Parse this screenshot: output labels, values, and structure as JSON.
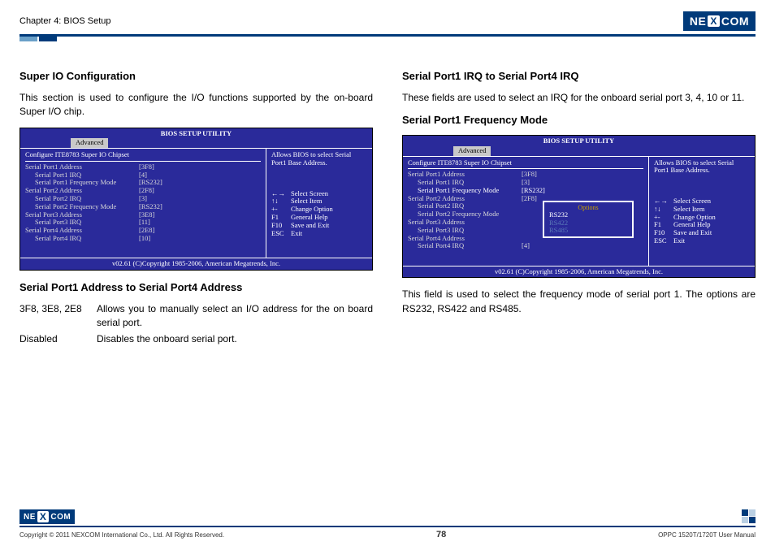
{
  "header": {
    "chapter": "Chapter 4: BIOS Setup",
    "brand_pre": "NE",
    "brand_x": "X",
    "brand_post": "COM"
  },
  "left": {
    "h1": "Super IO Configuration",
    "p1": "This section is used to configure the I/O functions supported by the on-board Super I/O chip.",
    "h2": "Serial Port1 Address to Serial Port4 Address",
    "defs": [
      {
        "k": "3F8, 3E8, 2E8",
        "v": "Allows you to manually select an I/O address for the on board serial port."
      },
      {
        "k": "Disabled",
        "v": "Disables the onboard serial port."
      }
    ]
  },
  "right": {
    "h1": "Serial Port1 IRQ to Serial Port4 IRQ",
    "p1": "These fields are used to select an IRQ for the onboard serial port 3, 4, 10 or 11.",
    "h2": "Serial Port1 Frequency Mode",
    "p2": "This field is used to select the frequency mode of serial port 1. The options are RS232, RS422 and RS485."
  },
  "bios_common": {
    "title": "BIOS SETUP UTILITY",
    "tab": "Advanced",
    "chipset": "Configure ITE8783 Super IO Chipset",
    "help": "Allows BIOS to select Serial Port1 Base Address.",
    "keys": [
      [
        "←→",
        "Select Screen"
      ],
      [
        "↑↓",
        "Select Item"
      ],
      [
        "+-",
        "Change Option"
      ],
      [
        "F1",
        "General Help"
      ],
      [
        "F10",
        "Save and Exit"
      ],
      [
        "ESC",
        "Exit"
      ]
    ],
    "foot": "v02.61 (C)Copyright 1985-2006, American Megatrends, Inc."
  },
  "bios1": {
    "rows": [
      [
        "Serial Port1 Address",
        "[3F8]",
        false,
        0
      ],
      [
        "Serial Port1 IRQ",
        "[4]",
        false,
        1
      ],
      [
        "Serial Port1 Frequency Mode",
        "[RS232]",
        false,
        1
      ],
      [
        "Serial Port2 Address",
        "[2F8]",
        false,
        0
      ],
      [
        "Serial Port2 IRQ",
        "[3]",
        false,
        1
      ],
      [
        "Serial Port2 Frequency Mode",
        "[RS232]",
        false,
        1
      ],
      [
        "Serial Port3 Address",
        "[3E8]",
        false,
        0
      ],
      [
        "Serial Port3 IRQ",
        "[11]",
        false,
        1
      ],
      [
        "Serial Port4 Address",
        "[2E8]",
        false,
        0
      ],
      [
        "Serial Port4 IRQ",
        "[10]",
        false,
        1
      ]
    ]
  },
  "bios2": {
    "rows": [
      [
        "Serial Port1 Address",
        "[3F8]",
        false,
        0
      ],
      [
        "Serial Port1 IRQ",
        "[3]",
        false,
        1
      ],
      [
        "Serial Port1 Frequency Mode",
        "[RS232]",
        true,
        1
      ],
      [
        "Serial Port2 Address",
        "[2F8]",
        false,
        0
      ],
      [
        "Serial Port2 IRQ",
        "",
        false,
        1
      ],
      [
        "Serial Port2 Frequency Mode",
        "",
        false,
        1
      ],
      [
        "Serial Port3 Address",
        "",
        false,
        0
      ],
      [
        "Serial Port3 IRQ",
        "",
        false,
        1
      ],
      [
        "Serial Port4 Address",
        "",
        false,
        0
      ],
      [
        "Serial Port4 IRQ",
        "[4]",
        false,
        1
      ]
    ],
    "popup": {
      "title": "Options",
      "opts": [
        "RS232",
        "RS422",
        "RS485"
      ],
      "sel": 0
    }
  },
  "footer": {
    "copy": "Copyright © 2011 NEXCOM International Co., Ltd. All Rights Reserved.",
    "page": "78",
    "manual": "OPPC 1520T/1720T User Manual"
  }
}
